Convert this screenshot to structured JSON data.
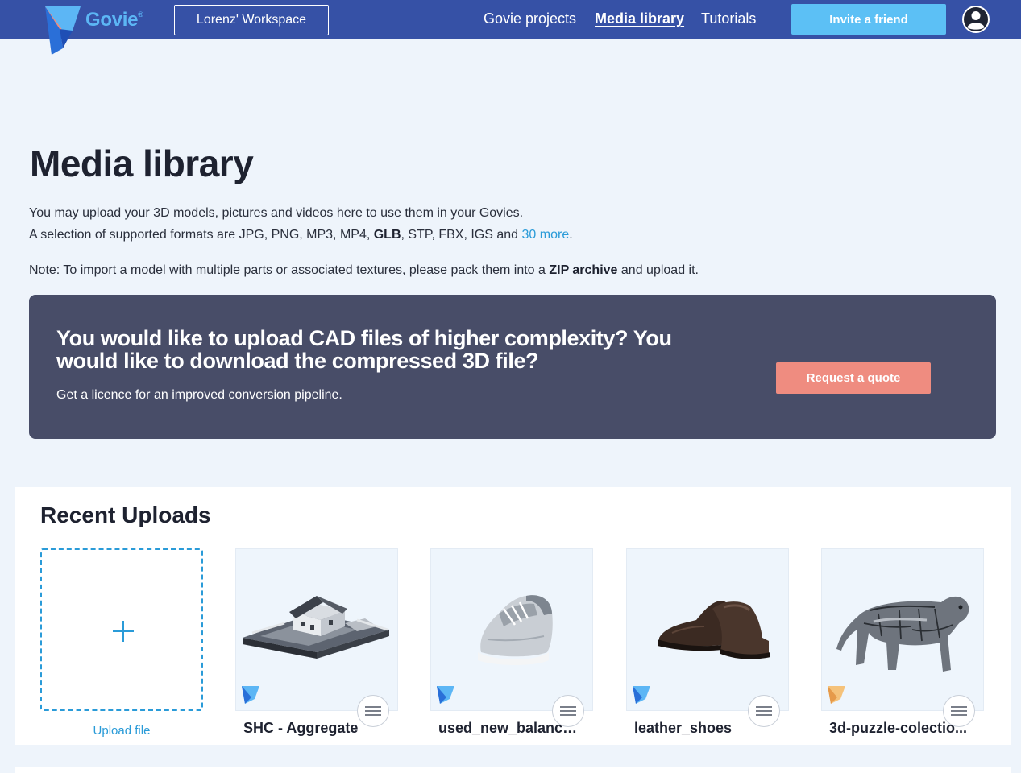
{
  "header": {
    "brand": "Govie",
    "brand_mark": "®",
    "workspace": "Lorenz' Workspace",
    "nav": [
      "Govie projects",
      "Media library",
      "Tutorials"
    ],
    "active_nav": "Media library",
    "invite": "Invite a friend",
    "colors": {
      "bar": "#3651a6",
      "accent": "#5cc0f5"
    }
  },
  "main": {
    "title": "Media library",
    "line1": "You may upload your 3D models, pictures and videos here to use them in your Govies.",
    "line2_before": "A selection of supported formats are JPG, PNG, MP3, MP4, ",
    "line2_bold": "GLB",
    "line2_after": ", STP, FBX, IGS and ",
    "line2_link": "30 more",
    "line2_end": ".",
    "note_before": "Note: To import a model with multiple parts or associated textures, please pack them into a ",
    "note_bold": "ZIP archive",
    "note_after": " and upload it."
  },
  "banner": {
    "title": "You would like to upload CAD files of higher complexity? You would like to download the compressed 3D file?",
    "subtitle": "Get a licence for an improved conversion pipeline.",
    "button": "Request a quote",
    "colors": {
      "background": "#484d68",
      "button": "#ef8c80"
    }
  },
  "uploads": {
    "title": "Recent Uploads",
    "upload_label": "Upload file",
    "items": [
      {
        "name": "SHC - Aggregate",
        "icon": "house-model-icon",
        "badge": "blue"
      },
      {
        "name": "used_new_balance_...",
        "icon": "sneaker-model-icon",
        "badge": "blue"
      },
      {
        "name": "leather_shoes",
        "icon": "leather-shoe-model-icon",
        "badge": "blue"
      },
      {
        "name": "3d-puzzle-colectio...",
        "icon": "tiger-model-icon",
        "badge": "orange"
      }
    ]
  }
}
